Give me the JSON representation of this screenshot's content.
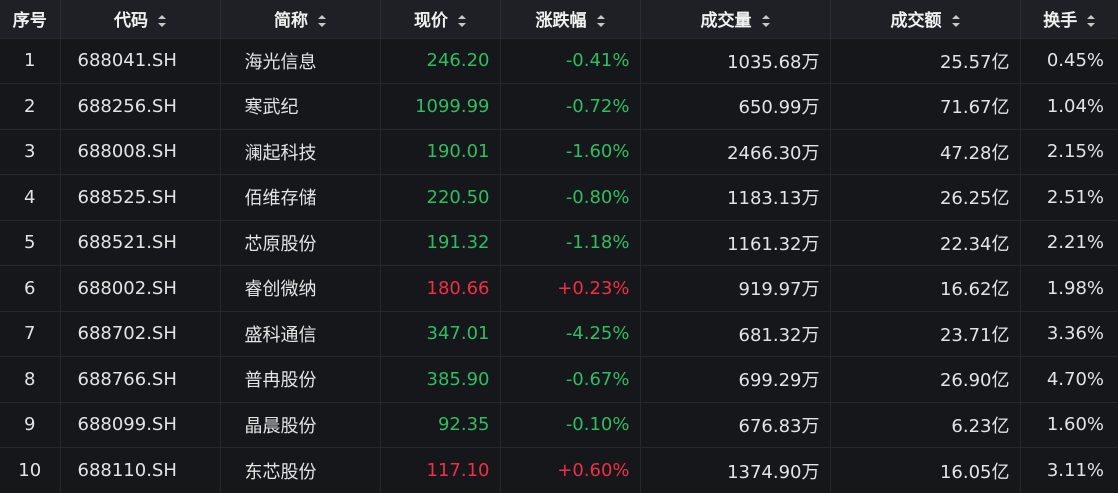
{
  "colors": {
    "background": "#16171b",
    "header_background": "#1f2025",
    "down": "#2ebd5f",
    "up": "#ef2f44",
    "text": "#e3e3e3"
  },
  "headers": {
    "index": "序号",
    "code": "代码",
    "name": "简称",
    "price": "现价",
    "change_pct": "涨跌幅",
    "volume": "成交量",
    "turnover": "成交额",
    "turnover_rate": "换手"
  },
  "rows": [
    {
      "index": "1",
      "code": "688041.SH",
      "name": "海光信息",
      "price": "246.20",
      "change_pct": "-0.41%",
      "volume": "1035.68万",
      "turnover": "25.57亿",
      "turnover_rate": "0.45%",
      "direction": "down"
    },
    {
      "index": "2",
      "code": "688256.SH",
      "name": "寒武纪",
      "price": "1099.99",
      "change_pct": "-0.72%",
      "volume": "650.99万",
      "turnover": "71.67亿",
      "turnover_rate": "1.04%",
      "direction": "down"
    },
    {
      "index": "3",
      "code": "688008.SH",
      "name": "澜起科技",
      "price": "190.01",
      "change_pct": "-1.60%",
      "volume": "2466.30万",
      "turnover": "47.28亿",
      "turnover_rate": "2.15%",
      "direction": "down"
    },
    {
      "index": "4",
      "code": "688525.SH",
      "name": "佰维存储",
      "price": "220.50",
      "change_pct": "-0.80%",
      "volume": "1183.13万",
      "turnover": "26.25亿",
      "turnover_rate": "2.51%",
      "direction": "down"
    },
    {
      "index": "5",
      "code": "688521.SH",
      "name": "芯原股份",
      "price": "191.32",
      "change_pct": "-1.18%",
      "volume": "1161.32万",
      "turnover": "22.34亿",
      "turnover_rate": "2.21%",
      "direction": "down"
    },
    {
      "index": "6",
      "code": "688002.SH",
      "name": "睿创微纳",
      "price": "180.66",
      "change_pct": "+0.23%",
      "volume": "919.97万",
      "turnover": "16.62亿",
      "turnover_rate": "1.98%",
      "direction": "up"
    },
    {
      "index": "7",
      "code": "688702.SH",
      "name": "盛科通信",
      "price": "347.01",
      "change_pct": "-4.25%",
      "volume": "681.32万",
      "turnover": "23.71亿",
      "turnover_rate": "3.36%",
      "direction": "down"
    },
    {
      "index": "8",
      "code": "688766.SH",
      "name": "普冉股份",
      "price": "385.90",
      "change_pct": "-0.67%",
      "volume": "699.29万",
      "turnover": "26.90亿",
      "turnover_rate": "4.70%",
      "direction": "down"
    },
    {
      "index": "9",
      "code": "688099.SH",
      "name": "晶晨股份",
      "price": "92.35",
      "change_pct": "-0.10%",
      "volume": "676.83万",
      "turnover": "6.23亿",
      "turnover_rate": "1.60%",
      "direction": "down"
    },
    {
      "index": "10",
      "code": "688110.SH",
      "name": "东芯股份",
      "price": "117.10",
      "change_pct": "+0.60%",
      "volume": "1374.90万",
      "turnover": "16.05亿",
      "turnover_rate": "3.11%",
      "direction": "up"
    }
  ]
}
